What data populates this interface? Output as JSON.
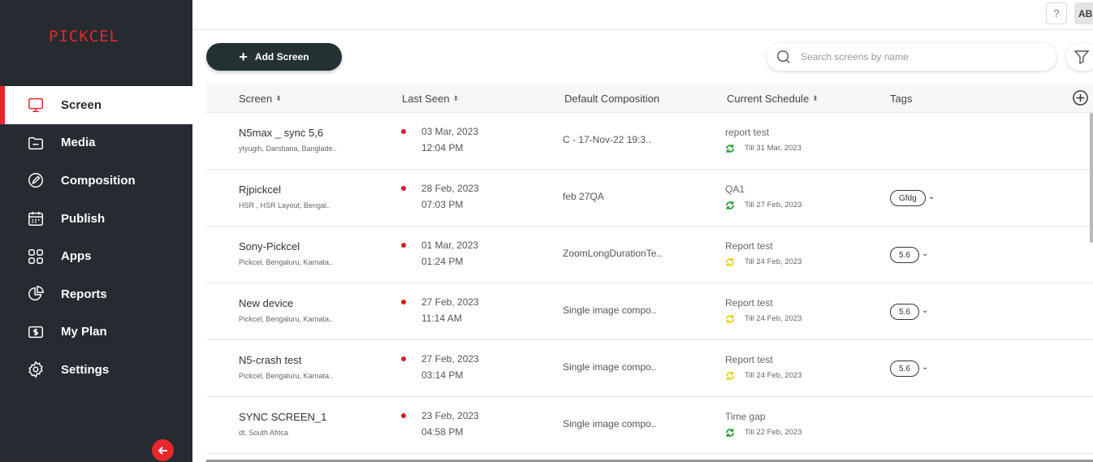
{
  "brand": {
    "logo_text": "PICKCEL",
    "accent": "#e8262d"
  },
  "sidebar": {
    "items": [
      {
        "label": "Screen",
        "icon": "monitor-icon",
        "active": true
      },
      {
        "label": "Media",
        "icon": "folder-icon",
        "active": false
      },
      {
        "label": "Composition",
        "icon": "edit-icon",
        "active": false
      },
      {
        "label": "Publish",
        "icon": "calendar-icon",
        "active": false
      },
      {
        "label": "Apps",
        "icon": "apps-grid-icon",
        "active": false
      },
      {
        "label": "Reports",
        "icon": "pie-chart-icon",
        "active": false
      },
      {
        "label": "My Plan",
        "icon": "billing-icon",
        "active": false
      },
      {
        "label": "Settings",
        "icon": "gear-icon",
        "active": false
      }
    ]
  },
  "topbar": {
    "help": "?",
    "avatar": "AB"
  },
  "toolbar": {
    "add_label": "Add Screen",
    "search_placeholder": "Search screens by name"
  },
  "table": {
    "headers": {
      "screen": "Screen",
      "last_seen": "Last Seen",
      "default_composition": "Default Composition",
      "current_schedule": "Current Schedule",
      "tags": "Tags"
    },
    "rows": [
      {
        "name": "N5max _ sync 5,6",
        "location": "ytyugih, Darshana, Banglade..",
        "date": "03 Mar, 2023",
        "time": "12:04 PM",
        "composition": "C - 17-Nov-22 19:3..",
        "schedule": "report test",
        "till": "Till 31 Mar, 2023",
        "sync_color": "#2e9e3a",
        "tag": ""
      },
      {
        "name": "Rjpickcel",
        "location": "HSR , HSR Layout, Bengal..",
        "date": "28 Feb, 2023",
        "time": "07:03 PM",
        "composition": "feb 27QA",
        "schedule": "QA1",
        "till": "Till 27 Feb, 2023",
        "sync_color": "#2e9e3a",
        "tag": "Gfdg"
      },
      {
        "name": "Sony-Pickcel",
        "location": "Pickcel, Bengaluru, Karnata..",
        "date": "01 Mar, 2023",
        "time": "01:24 PM",
        "composition": "ZoomLongDurationTe..",
        "schedule": "Report test",
        "till": "Till 24 Feb, 2023",
        "sync_color": "#e6d21a",
        "tag": "5.6"
      },
      {
        "name": "New device",
        "location": "Pickcel, Bengaluru, Karnata..",
        "date": "27 Feb, 2023",
        "time": "11:14 AM",
        "composition": "Single image compo..",
        "schedule": "Report test",
        "till": "Till 24 Feb, 2023",
        "sync_color": "#e6d21a",
        "tag": "5.6"
      },
      {
        "name": "N5-crash test",
        "location": "Pickcel, Bengaluru, Karnata..",
        "date": "27 Feb, 2023",
        "time": "03:14 PM",
        "composition": "Single image compo..",
        "schedule": "Report test",
        "till": "Till 24 Feb, 2023",
        "sync_color": "#e6d21a",
        "tag": "5.6"
      },
      {
        "name": "SYNC SCREEN_1",
        "location": "dt, South Africa",
        "date": "23 Feb, 2023",
        "time": "04:58 PM",
        "composition": "Single image compo..",
        "schedule": "Time gap",
        "till": "Till 22 Feb, 2023",
        "sync_color": "#2e9e3a",
        "tag": ""
      }
    ]
  }
}
